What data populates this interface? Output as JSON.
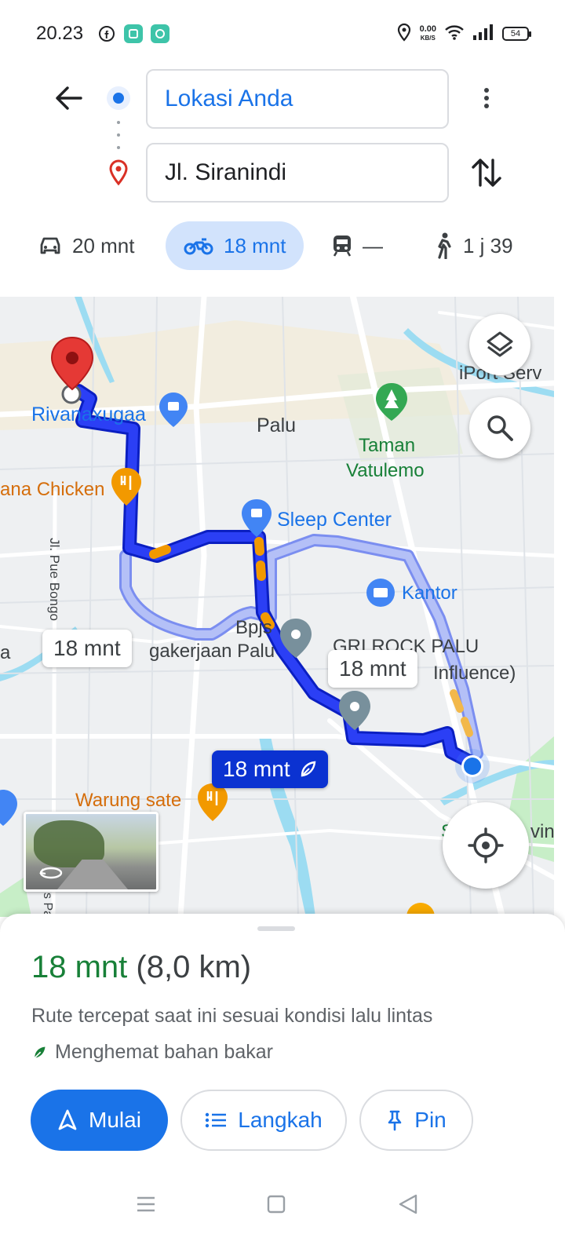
{
  "status_bar": {
    "time": "20.23",
    "net_speed_value": "0.00",
    "net_speed_unit": "KB/S",
    "battery": "54"
  },
  "search": {
    "origin": "Lokasi Anda",
    "destination": "Jl. Siranindi"
  },
  "modes": [
    {
      "name": "car",
      "label": "20 mnt",
      "selected": false
    },
    {
      "name": "motorcycle",
      "label": "18 mnt",
      "selected": true
    },
    {
      "name": "transit",
      "label": "—",
      "selected": false
    },
    {
      "name": "walking",
      "label": "1 j 39",
      "selected": false
    }
  ],
  "map": {
    "labels": {
      "rivanaxugaa": "Rivanaxugaa",
      "palu": "Palu",
      "taman_line1": "Taman",
      "taman_line2": "Vatulemo",
      "chicken": "ana Chicken",
      "sleep_center": "Sleep Center",
      "kantor": "Kantor",
      "street_pue_bongo": "Jl. Pue Bongo",
      "bpjs": "Bpjs",
      "ketenagakerjaan": "gakerjaan Palu",
      "gri_rock_line1": "GRI ROCK PALU",
      "gri_rock_line2": "Influence)",
      "iport": "iPort Serv",
      "warung_sate": "Warung sate",
      "edge_a": "a",
      "edge_vin": "vin",
      "edge_s": "S",
      "street_bottom": "s Pa"
    },
    "route_chips": {
      "alt1": "18 mnt",
      "alt2": "18 mnt",
      "main": "18 mnt"
    },
    "colors": {
      "route_main": "#1a2cf0",
      "route_alt": "#a6b3f5",
      "traffic": "#f29900",
      "water": "#9cdcf2",
      "park": "#c7eec7"
    }
  },
  "sheet": {
    "time": "18 mnt",
    "distance": "(8,0 km)",
    "description": "Rute tercepat saat ini sesuai kondisi lalu lintas",
    "fuel_note": "Menghemat bahan bakar",
    "buttons": {
      "start": "Mulai",
      "steps": "Langkah",
      "pin": "Pin"
    }
  }
}
